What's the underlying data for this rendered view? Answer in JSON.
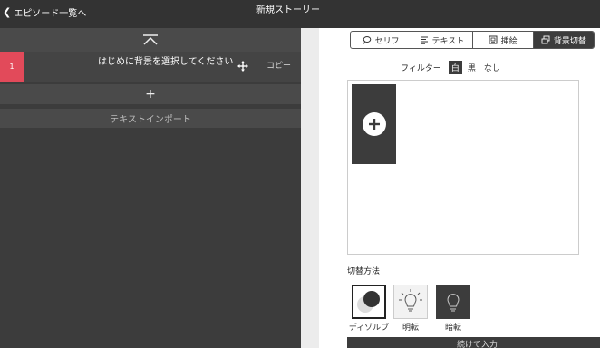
{
  "header": {
    "back_label": "エピソード一覧へ",
    "title": "新規ストーリー"
  },
  "left": {
    "scene": {
      "number": "1",
      "text": "はじめに背景を選択してください",
      "copy_label": "コピー"
    },
    "add_label": "+",
    "import_label": "テキストインポート"
  },
  "right": {
    "tabs": [
      {
        "label": "セリフ",
        "icon": "speech-bubble-icon"
      },
      {
        "label": "テキスト",
        "icon": "text-lines-icon"
      },
      {
        "label": "挿絵",
        "icon": "picture-icon"
      },
      {
        "label": "背景切替",
        "icon": "background-switch-icon"
      }
    ],
    "active_tab": "背景切替",
    "filter": {
      "label": "フィルター",
      "options": [
        "白",
        "黒",
        "なし"
      ],
      "selected": "白"
    },
    "switch_method": {
      "label": "切替方法",
      "options": [
        "ディゾルブ",
        "明転",
        "暗転"
      ]
    },
    "continue_label": "続けて入力"
  },
  "colors": {
    "accent_red": "#e24a5a",
    "dark": "#3c3c3c"
  }
}
